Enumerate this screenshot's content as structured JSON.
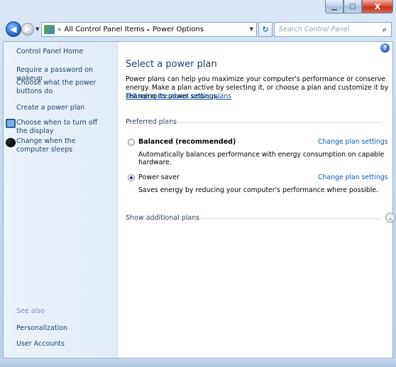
{
  "window": {
    "caption_min": "▁",
    "caption_max": "□",
    "caption_close": "X"
  },
  "navigation": {
    "back_glyph": "◀",
    "forward_glyph": "▶",
    "breadcrumb_chevron": "«",
    "breadcrumb": [
      "All Control Panel Items",
      "Power Options"
    ],
    "breadcrumb_separator": "▸",
    "refresh_glyph": "↻",
    "search_placeholder": "Search Control Panel",
    "search_glyph": "⌕"
  },
  "sidebar": {
    "home": "Control Panel Home",
    "tasks": [
      {
        "label": "Require a password on wakeup"
      },
      {
        "label": "Choose what the power buttons do"
      },
      {
        "label": "Create a power plan"
      },
      {
        "label": "Choose when to turn off the display",
        "icon": "monitor-icon"
      },
      {
        "label": "Change when the computer sleeps",
        "icon": "moon-icon"
      }
    ],
    "see_also_label": "See also",
    "see_also": [
      "Personalization",
      "User Accounts"
    ]
  },
  "main": {
    "help_glyph": "?",
    "title": "Select a power plan",
    "description": "Power plans can help you maximize your computer's performance or conserve energy. Make a plan active by selecting it, or choose a plan and customize it by changing its power settings.",
    "learn_more": "Tell me more about power plans",
    "preferred_label": "Preferred plans",
    "plans": [
      {
        "name": "Balanced (recommended)",
        "description": "Automatically balances performance with energy consumption on capable hardware.",
        "change_link": "Change plan settings",
        "selected": false
      },
      {
        "name": "Power saver",
        "description": "Saves energy by reducing your computer's performance where possible.",
        "change_link": "Change plan settings",
        "selected": true
      }
    ],
    "show_additional": "Show additional plans",
    "expand_glyph": "⌄"
  },
  "colors": {
    "link": "#0b56b5",
    "title": "#1e3a6c",
    "sidebar_bg": "#e6eff9",
    "close_button": "#c2331a"
  }
}
